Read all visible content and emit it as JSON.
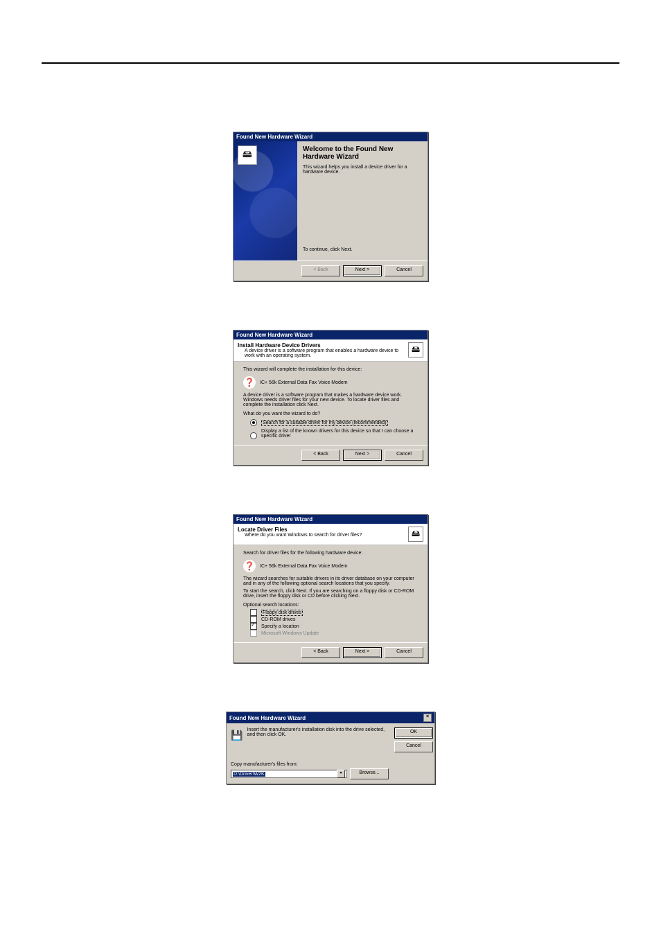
{
  "s1": {
    "title": "Found New Hardware Wizard",
    "heading_line1": "Welcome to the Found New",
    "heading_line2": "Hardware Wizard",
    "intro": "This wizard helps you install a device driver for a hardware device.",
    "continue": "To continue, click Next.",
    "back": "< Back",
    "next": "Next >",
    "cancel": "Cancel"
  },
  "s2": {
    "title": "Found New Hardware Wizard",
    "head_title": "Install Hardware Device Drivers",
    "head_sub": "A device driver is a software program that enables a hardware device to work with an operating system.",
    "line1": "This wizard will complete the installation for this device:",
    "device": "IC+ 56k External Data Fax Voice Modem",
    "expl": "A device driver is a software program that makes a hardware device work. Windows needs driver files for your new device. To locate driver files and complete the installation click Next.",
    "prompt": "What do you want the wizard to do?",
    "opt1": "Search for a suitable driver for my device (recommended)",
    "opt2": "Display a list of the known drivers for this device so that I can choose a specific driver",
    "back": "< Back",
    "next": "Next >",
    "cancel": "Cancel"
  },
  "s3": {
    "title": "Found New Hardware Wizard",
    "head_title": "Locate Driver Files",
    "head_sub": "Where do you want Windows to search for driver files?",
    "line1": "Search for driver files for the following hardware device:",
    "device": "IC+ 56k External Data Fax Voice Modem",
    "expl1": "The wizard searches for suitable drivers in its driver database on your computer and in any of the following optional search locations that you specify.",
    "expl2": "To start the search, click Next. If you are searching on a floppy disk or CD-ROM drive, insert the floppy disk or CD before clicking Next.",
    "opt_label": "Optional search locations:",
    "o1": "Floppy disk drives",
    "o2": "CD-ROM drives",
    "o3": "Specify a location",
    "o4": "Microsoft Windows Update",
    "back": "< Back",
    "next": "Next >",
    "cancel": "Cancel"
  },
  "s4": {
    "title": "Found New Hardware Wizard",
    "msg": "Insert the manufacturer's installation disk into the drive selected, and then click OK.",
    "copy_label": "Copy manufacturer's files from:",
    "path": "D:\\Driver\\W2K",
    "ok": "OK",
    "cancel": "Cancel",
    "browse": "Browse..."
  }
}
